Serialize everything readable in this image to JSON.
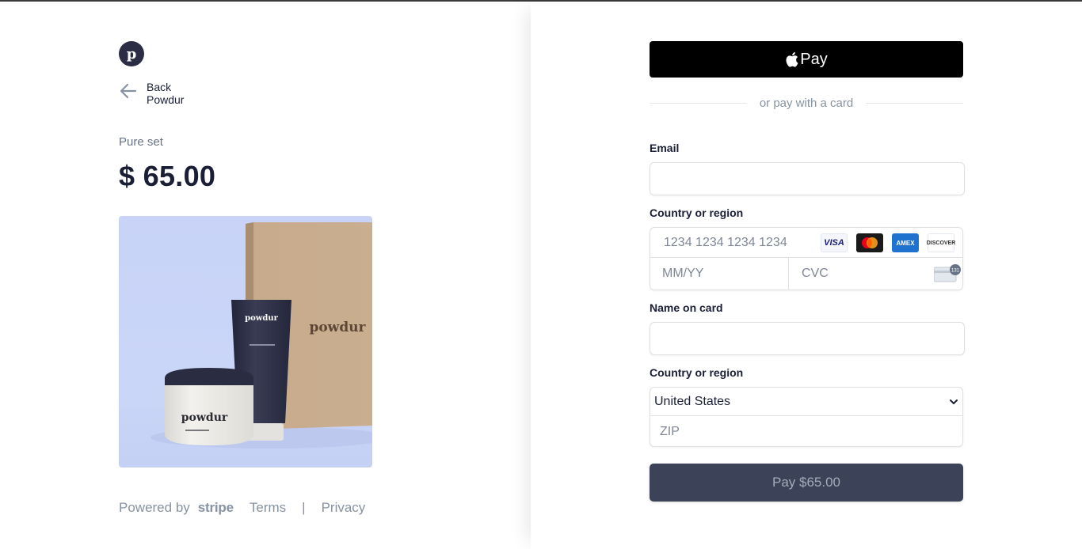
{
  "merchant": {
    "logo_letter": "p",
    "back_label": "Back",
    "back_name": "Powdur"
  },
  "product": {
    "name": "Pure set",
    "price": "$ 65.00",
    "image_label_box": "powdur",
    "image_label_tube": "powdur",
    "image_label_jar": "powdur"
  },
  "footer": {
    "powered_by": "Powered by",
    "stripe": "stripe",
    "terms": "Terms",
    "separator": "|",
    "privacy": "Privacy"
  },
  "payment": {
    "apple_pay_label": "Pay",
    "divider_text": "or pay with a card",
    "email_label": "Email",
    "email_value": "",
    "card_label": "Country or region",
    "card_number_placeholder": "1234 1234 1234 1234",
    "card_brands": [
      "VISA",
      "Mastercard",
      "AMEX",
      "DISCOVER"
    ],
    "expiry_placeholder": "MM/YY",
    "cvc_placeholder": "CVC",
    "cvc_icon_text": "131",
    "name_label": "Name on card",
    "name_value": "",
    "country_label": "Country or region",
    "country_selected": "United States",
    "zip_placeholder": "ZIP",
    "pay_button": "Pay $65.00"
  },
  "colors": {
    "logo_bg": "#2b2d44",
    "pay_button_bg": "#3c4257",
    "pay_button_text": "#a3acb9",
    "product_bg": "#c8d3f7"
  }
}
